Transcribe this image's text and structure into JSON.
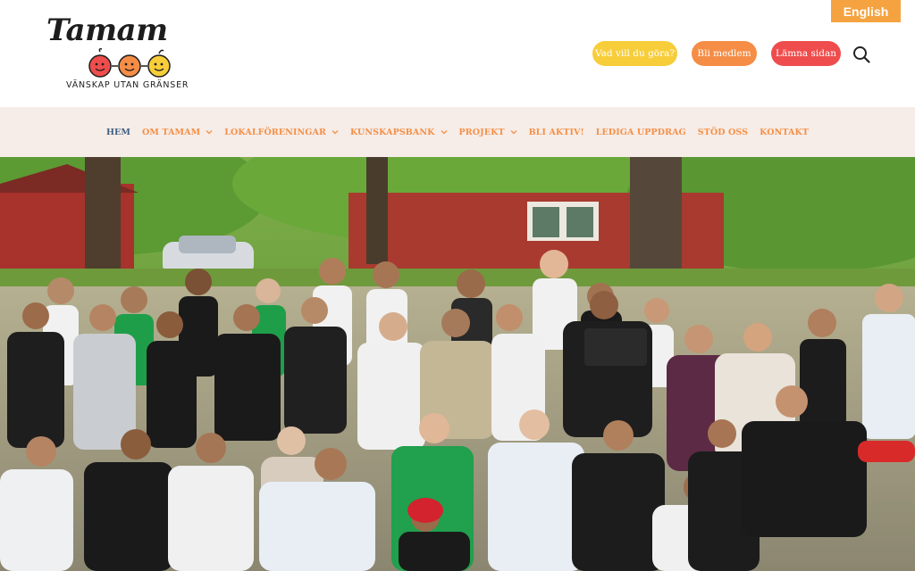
{
  "header": {
    "logo": {
      "wordmark": "Tamam",
      "tagline": "VÄNSKAP UTAN GRÄNSER"
    },
    "language_button": "English",
    "pills": [
      {
        "label": "Vad vill du göra?",
        "color": "#f7cd3a"
      },
      {
        "label": "Bli medlem",
        "color": "#f58d46"
      },
      {
        "label": "Lämna sidan",
        "color": "#ef4d4d"
      }
    ],
    "search_icon": "search-icon"
  },
  "nav": {
    "items": [
      {
        "label": "HEM",
        "active": true,
        "has_dropdown": false
      },
      {
        "label": "OM TAMAM",
        "active": false,
        "has_dropdown": true
      },
      {
        "label": "LOKALFÖRENINGAR",
        "active": false,
        "has_dropdown": true
      },
      {
        "label": "KUNSKAPSBANK",
        "active": false,
        "has_dropdown": true
      },
      {
        "label": "PROJEKT",
        "active": false,
        "has_dropdown": true
      },
      {
        "label": "BLI AKTIV!",
        "active": false,
        "has_dropdown": false
      },
      {
        "label": "LEDIGA UPPDRAG",
        "active": false,
        "has_dropdown": false
      },
      {
        "label": "STÖD OSS",
        "active": false,
        "has_dropdown": false
      },
      {
        "label": "KONTAKT",
        "active": false,
        "has_dropdown": false
      }
    ]
  },
  "colors": {
    "accent_orange": "#f58d46",
    "nav_background": "#f6ece8",
    "nav_active": "#3e5f7f",
    "language_button": "#f5a340"
  }
}
